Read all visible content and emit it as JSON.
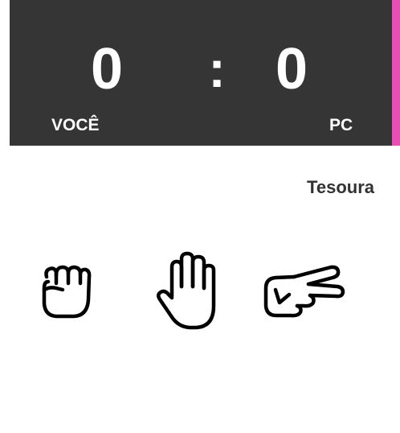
{
  "scoreboard": {
    "player_score": "0",
    "separator": ":",
    "pc_score": "0",
    "player_label": "VOCÊ",
    "pc_label": "PC",
    "background_color": "#353535",
    "accent_color": "#e84fb4"
  },
  "pc_choice": {
    "label": "Tesoura"
  },
  "choices": [
    {
      "name": "rock",
      "icon": "fist-icon"
    },
    {
      "name": "paper",
      "icon": "open-hand-icon"
    },
    {
      "name": "scissors",
      "icon": "scissors-hand-icon"
    }
  ]
}
